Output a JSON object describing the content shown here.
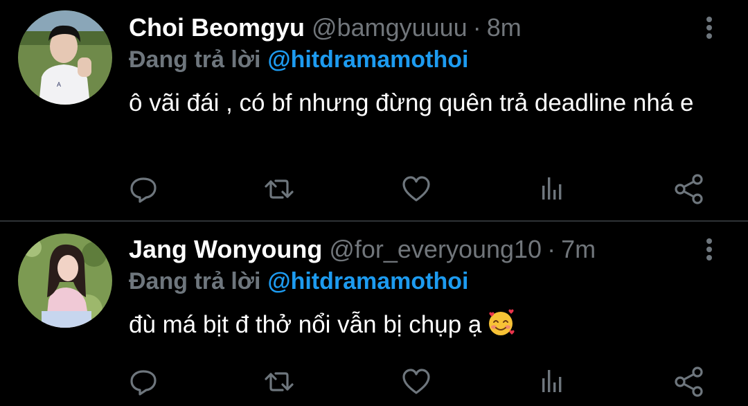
{
  "colors": {
    "background": "#000000",
    "divider": "#2f3336",
    "name": "#ffffff",
    "secondary": "#71767b",
    "mention": "#1d9bf0",
    "icon": "#6e767d"
  },
  "tweets": [
    {
      "name": "Choi Beomgyu",
      "handle": "@bamgyuuuu",
      "separator": "·",
      "time": "8m",
      "replying_label": "Đang trả lời",
      "replying_to": "@hitdramamothoi",
      "text": "ô vãi đái , có bf nhưng đừng quên trả deadline nhá e",
      "emoji": "",
      "icons": {
        "reply": "reply-icon",
        "retweet": "retweet-icon",
        "like": "like-icon",
        "views": "views-icon",
        "share": "share-icon",
        "more": "more-options-icon"
      }
    },
    {
      "name": "Jang Wonyoung",
      "handle": "@for_everyoung10",
      "separator": "·",
      "time": "7m",
      "replying_label": "Đang trả lời",
      "replying_to": "@hitdramamothoi",
      "text": "đù má bịt đ thở nổi vẫn bị chụp ạ",
      "emoji": "smiling-face-with-hearts",
      "icons": {
        "reply": "reply-icon",
        "retweet": "retweet-icon",
        "like": "like-icon",
        "views": "views-icon",
        "share": "share-icon",
        "more": "more-options-icon"
      }
    }
  ]
}
